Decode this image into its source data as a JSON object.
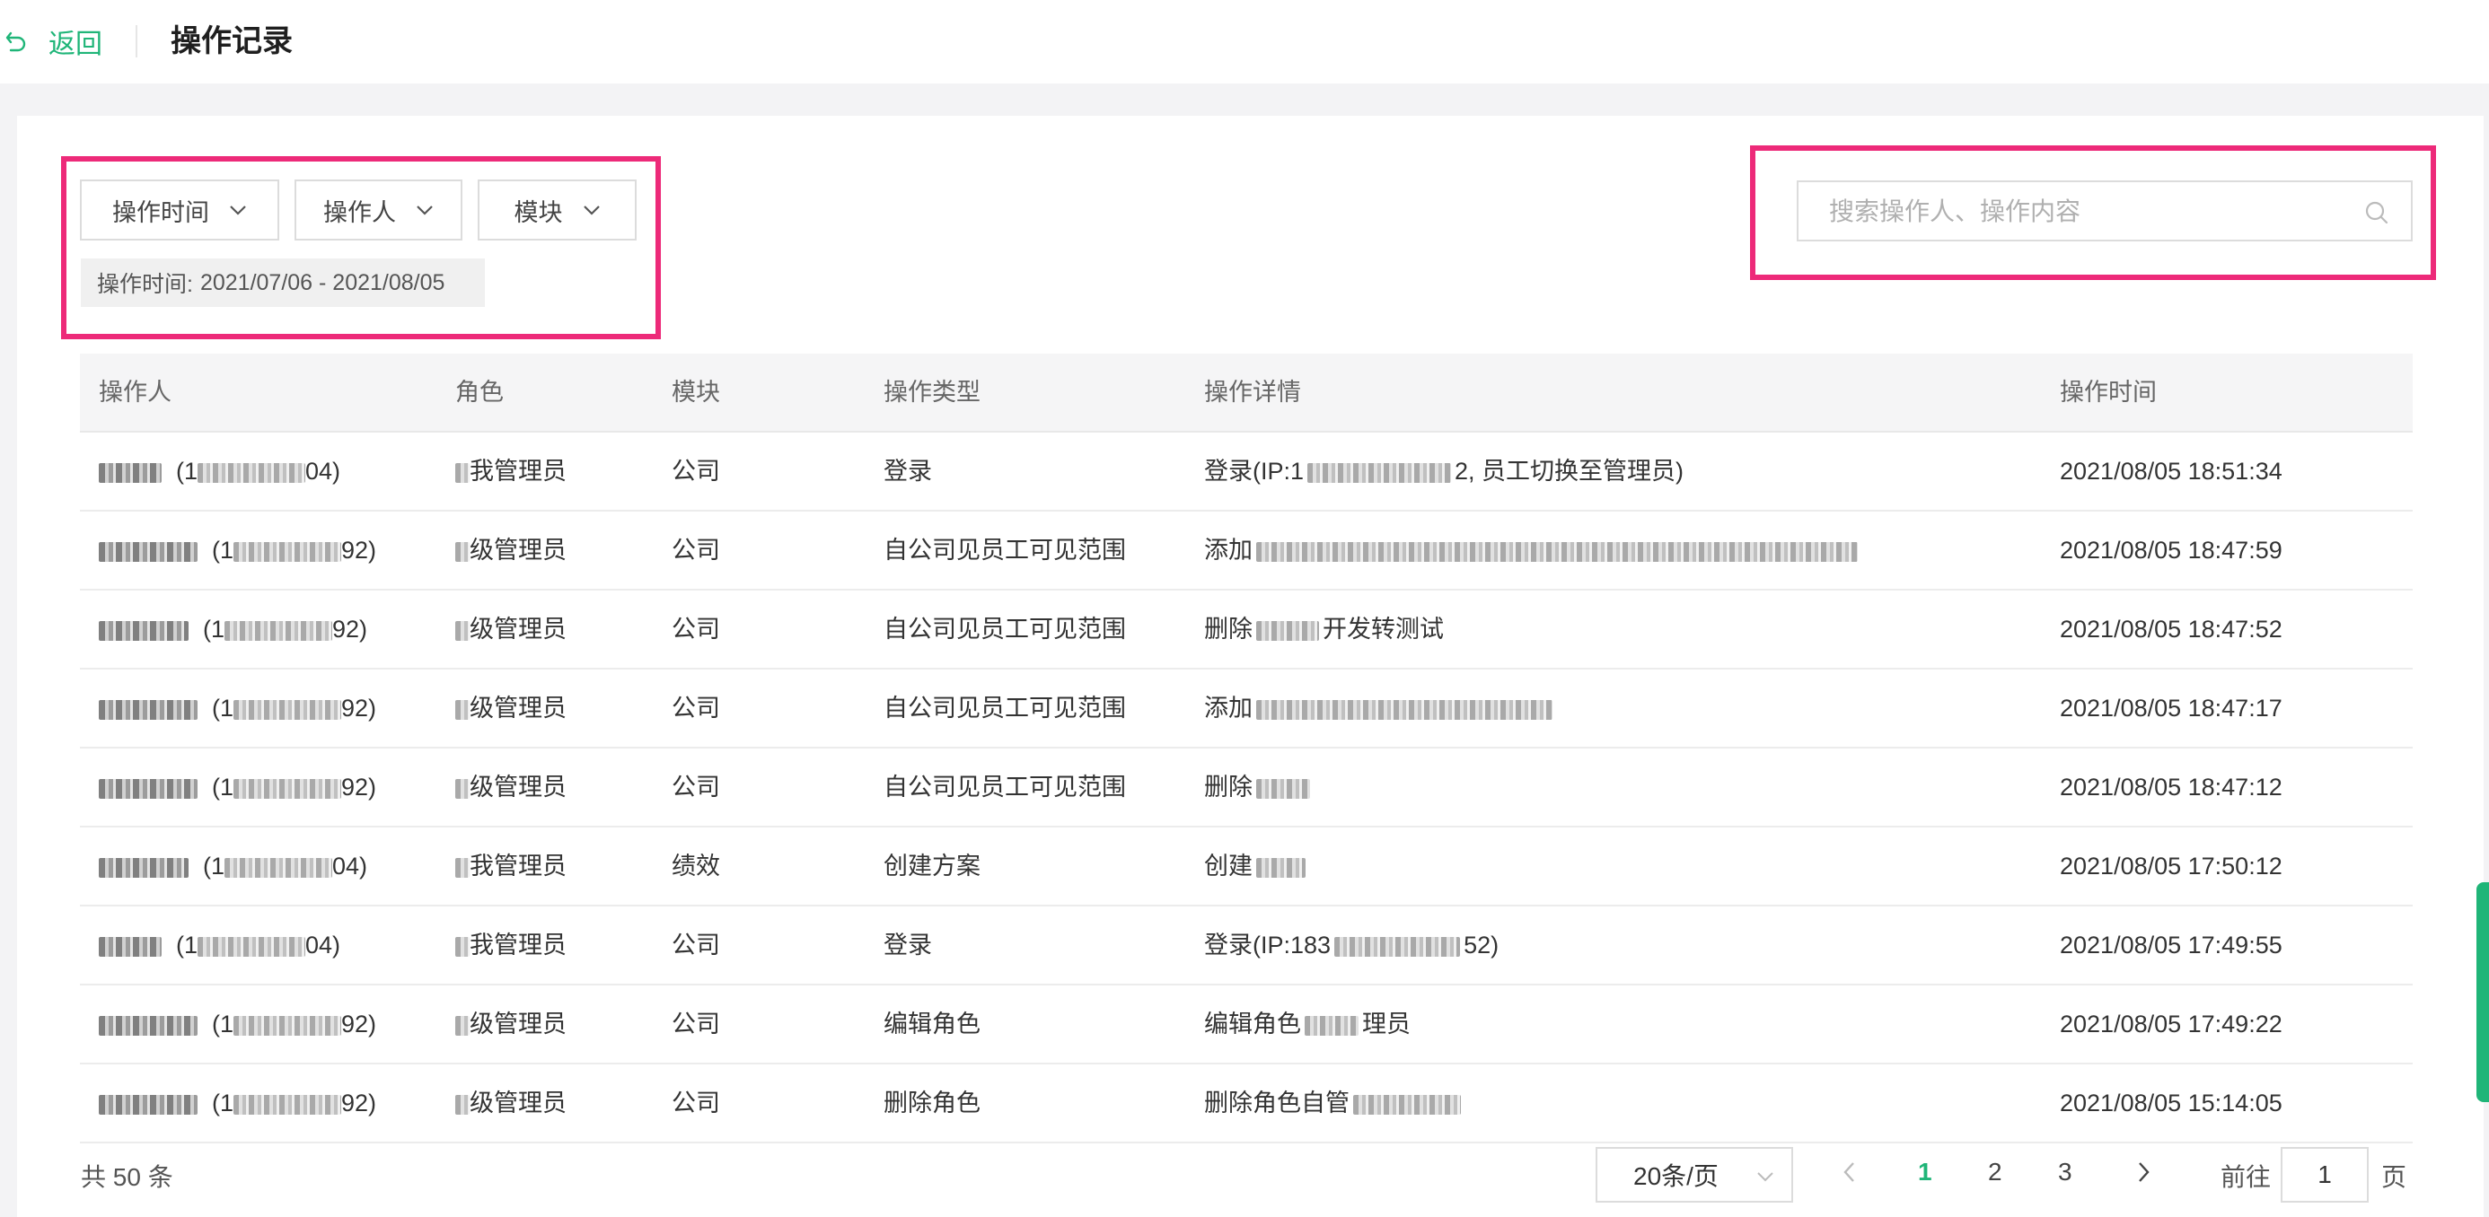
{
  "header": {
    "back_label": "返回",
    "title": "操作记录"
  },
  "filters": {
    "buttons": [
      {
        "label": "操作时间"
      },
      {
        "label": "操作人"
      },
      {
        "label": "模块"
      }
    ],
    "active_chip_prefix": "操作时间:",
    "active_chip_value": "2021/07/06 - 2021/08/05"
  },
  "search": {
    "placeholder": "搜索操作人、操作内容",
    "value": ""
  },
  "table": {
    "columns": [
      "操作人",
      "角色",
      "模块",
      "操作类型",
      "操作详情",
      "操作时间"
    ],
    "rows": [
      {
        "operator_suffix": "04)",
        "role": "我管理员",
        "module": "公司",
        "type": "登录",
        "detail_prefix": "登录(IP:1",
        "detail_suffix": "2, 员工切换至管理员)",
        "time": "2021/08/05 18:51:34"
      },
      {
        "operator_suffix": "92)",
        "role": "级管理员",
        "module": "公司",
        "type": "自公司见员工可见范围",
        "detail_prefix": "添加",
        "detail_suffix": "",
        "time": "2021/08/05 18:47:59"
      },
      {
        "operator_suffix": "92)",
        "role": "级管理员",
        "module": "公司",
        "type": "自公司见员工可见范围",
        "detail_prefix": "删除",
        "detail_suffix": "开发转测试",
        "time": "2021/08/05 18:47:52"
      },
      {
        "operator_suffix": "92)",
        "role": "级管理员",
        "module": "公司",
        "type": "自公司见员工可见范围",
        "detail_prefix": "添加",
        "detail_suffix": "",
        "time": "2021/08/05 18:47:17"
      },
      {
        "operator_suffix": "92)",
        "role": "级管理员",
        "module": "公司",
        "type": "自公司见员工可见范围",
        "detail_prefix": "删除",
        "detail_suffix": "",
        "time": "2021/08/05 18:47:12"
      },
      {
        "operator_suffix": "04)",
        "role": "我管理员",
        "module": "绩效",
        "type": "创建方案",
        "detail_prefix": "创建",
        "detail_suffix": "",
        "time": "2021/08/05 17:50:12"
      },
      {
        "operator_suffix": "04)",
        "role": "我管理员",
        "module": "公司",
        "type": "登录",
        "detail_prefix": "登录(IP:183",
        "detail_suffix": "52)",
        "time": "2021/08/05 17:49:55"
      },
      {
        "operator_suffix": "92)",
        "role": "级管理员",
        "module": "公司",
        "type": "编辑角色",
        "detail_prefix": "编辑角色",
        "detail_suffix": "理员",
        "time": "2021/08/05 17:49:22"
      },
      {
        "operator_suffix": "92)",
        "role": "级管理员",
        "module": "公司",
        "type": "删除角色",
        "detail_prefix": "删除角色自管",
        "detail_suffix": "",
        "time": "2021/08/05 15:14:05"
      }
    ]
  },
  "pagination": {
    "total_text": "共 50 条",
    "page_size": "20条/页",
    "pages": [
      "1",
      "2",
      "3"
    ],
    "current_page": "1",
    "goto_label": "前往",
    "goto_value": "1",
    "page_suffix": "页"
  },
  "colors": {
    "accent": "#1fb578",
    "highlight": "#ed2a79"
  },
  "icons": [
    "undo-icon",
    "chevron-down-icon",
    "search-icon",
    "chevron-left-icon",
    "chevron-right-icon"
  ]
}
